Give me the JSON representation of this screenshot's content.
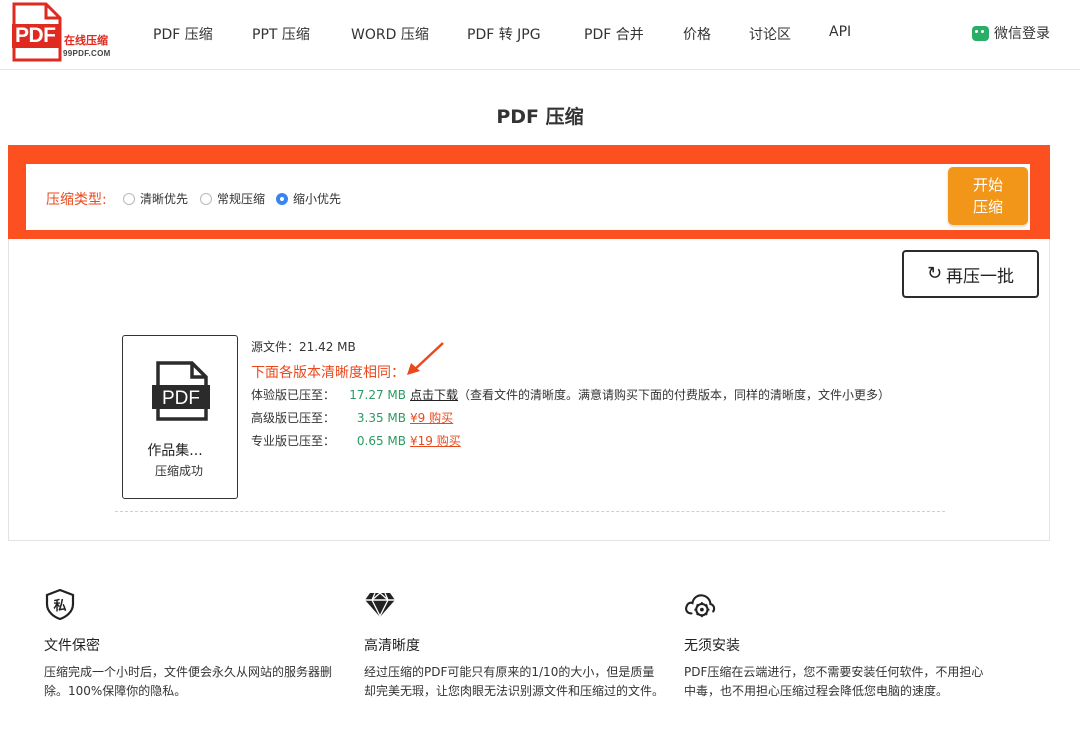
{
  "brand": {
    "logo_text": "PDF",
    "logo_cn": "在线压缩",
    "logo_domain": "99PDF.COM"
  },
  "nav": {
    "items": [
      {
        "label": "PDF 压缩"
      },
      {
        "label": "PPT 压缩"
      },
      {
        "label": "WORD 压缩"
      },
      {
        "label": "PDF 转 JPG"
      },
      {
        "label": "PDF 合并"
      },
      {
        "label": "价格"
      },
      {
        "label": "讨论区"
      },
      {
        "label": "API"
      }
    ],
    "login_label": "微信登录"
  },
  "page_title": "PDF 压缩",
  "compress_options": {
    "label": "压缩类型:",
    "options": [
      {
        "label": "清晰优先",
        "checked": false
      },
      {
        "label": "常规压缩",
        "checked": false
      },
      {
        "label": "缩小优先",
        "checked": true
      }
    ],
    "start_line1": "开始",
    "start_line2": "压缩"
  },
  "result": {
    "recompress_label": "再压一批",
    "file_name": "作品集...",
    "file_status": "压缩成功",
    "pdf_badge": "PDF",
    "source_label": "源文件：",
    "source_size": "21.42 MB",
    "notice": "下面各版本清晰度相同：",
    "trial_label": "体验版已压至：",
    "trial_size": "17.27 MB",
    "trial_link": "点击下载",
    "trial_note": "（查看文件的清晰度。满意请购买下面的付费版本，同样的清晰度，文件小更多）",
    "advanced_label": "高级版已压至：",
    "advanced_size": "3.35 MB",
    "advanced_price": "¥9 购买",
    "pro_label": "专业版已压至：",
    "pro_size": "0.65 MB",
    "pro_price": "¥19 购买"
  },
  "features": [
    {
      "icon": "private-shield-icon",
      "badge": "私",
      "title": "文件保密",
      "desc": "压缩完成一个小时后，文件便会永久从网站的服务器删除。100%保障你的隐私。"
    },
    {
      "icon": "diamond-icon",
      "title": "高清晰度",
      "desc": "经过压缩的PDF可能只有原来的1/10的大小，但是质量却完美无瑕，让您肉眼无法识别源文件和压缩过的文件。"
    },
    {
      "icon": "cloud-gear-icon",
      "title": "无须安装",
      "desc": "PDF压缩在云端进行，您不需要安装任何软件，不用担心中毒，也不用担心压缩过程会降低您电脑的速度。"
    }
  ],
  "colors": {
    "accent_orange": "#fd5021",
    "button_orange": "#f29619",
    "success_green": "#2b9a62",
    "radio_blue": "#3a84f0"
  }
}
